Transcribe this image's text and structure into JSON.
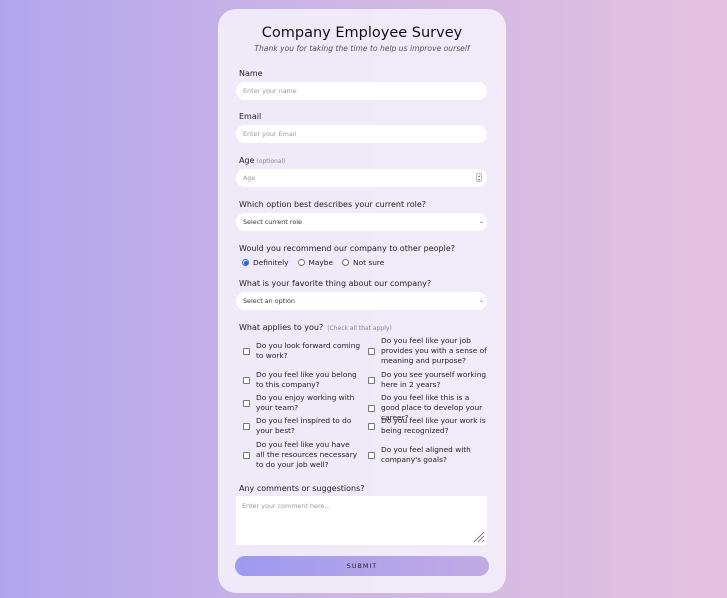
{
  "form": {
    "title": "Company Employee Survey",
    "subtitle": "Thank you for taking the time to help us improve ourself",
    "name_label": "Name",
    "name_placeholder": "Enter your name",
    "email_label": "Email",
    "email_placeholder": "Enter your Email",
    "age_label": "Age",
    "age_optional": "(optional)",
    "age_placeholder": "Age",
    "role_question": "Which option best describes your current role?",
    "role_value": "Select current role",
    "recommend_question": "Would you recommend our company to other people?",
    "recommend_options": [
      "Definitely",
      "Maybe",
      "Not sure"
    ],
    "recommend_selected": "Definitely",
    "favorite_question": "What is your favorite thing about our company?",
    "favorite_value": "Select an option",
    "applies_question": "What applies to you?",
    "applies_hint": "(Check all that apply)",
    "checkboxes_left": [
      "Do you look forward coming to work?",
      "Do you feel like you belong to this company?",
      "Do you enjoy working with your team?",
      "Do you feel inspired to do your best?",
      "Do you feel like you have all the resources necessary to do your job well?"
    ],
    "checkboxes_right": [
      "Do you feel like your job provides you with a sense of meaning and purpose?",
      "Do you see yourself working here in 2 years?",
      "Do you feel like this is a good place to develop your career?",
      "Do you feel like your work is being recognized?",
      "Do you feel aligned with company's goals?"
    ],
    "comments_label": "Any comments or suggestions?",
    "comments_placeholder": "Enter your comment here...",
    "submit_label": "SUBMIT"
  },
  "colors": {
    "radio_accent": "#2866d8",
    "submit_start": "#9e9aef",
    "submit_end": "#c2abe4"
  }
}
